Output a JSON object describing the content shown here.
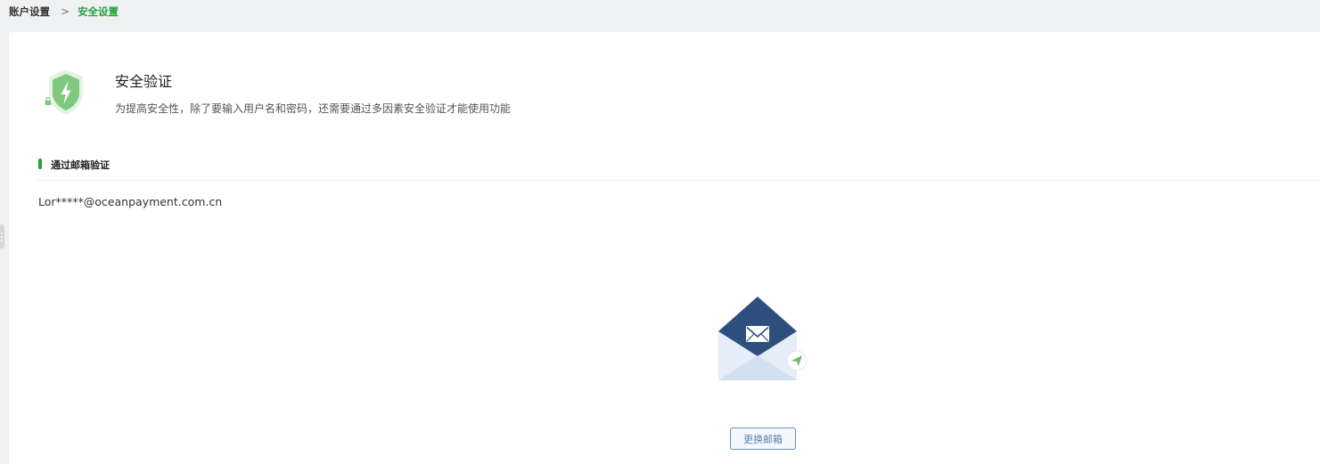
{
  "breadcrumb": {
    "parent": "账户设置",
    "separator": ">",
    "current": "安全设置"
  },
  "security": {
    "title": "安全验证",
    "description": "为提高安全性，除了要输入用户名和密码，还需要通过多因素安全验证才能使用功能",
    "icon": "shield-bolt-icon"
  },
  "email_verification": {
    "section_label": "通过邮箱验证",
    "email": "Lor*****@oceanpayment.com.cn",
    "illustration_icon": "envelope-icon",
    "change_button_label": "更换邮箱"
  },
  "colors": {
    "accent_green": "#27a03d",
    "envelope_navy": "#2e4f7e",
    "button_border": "#6e8fbd"
  }
}
